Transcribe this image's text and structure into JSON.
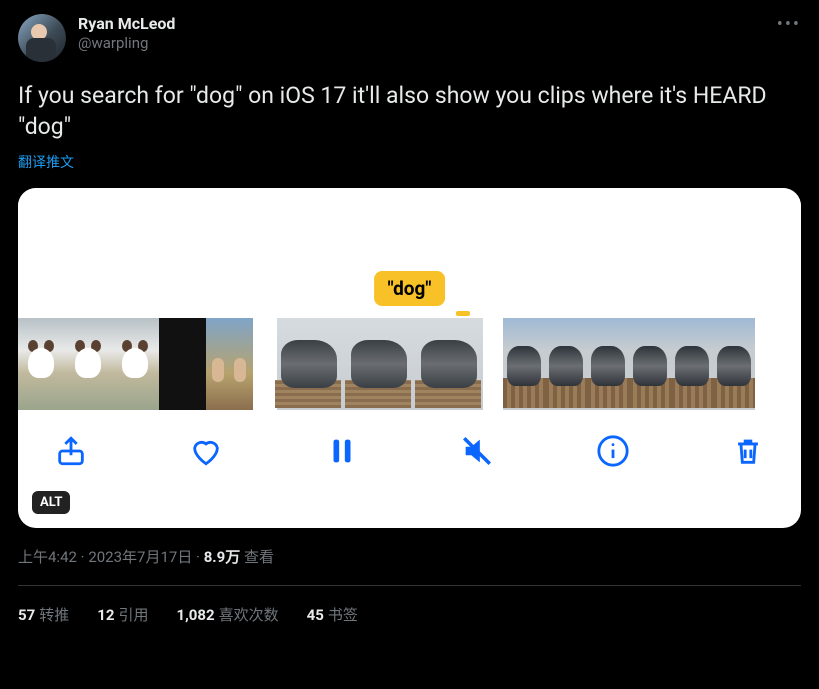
{
  "author": {
    "display_name": "Ryan McLeod",
    "handle": "@warpling"
  },
  "body_text": "If you search for \"dog\" on iOS 17 it'll also show you clips where it's HEARD \"dog\"",
  "translate_label": "翻译推文",
  "media": {
    "tag_label": "\"dog\"",
    "alt_badge": "ALT"
  },
  "meta": {
    "time": "上午4:42",
    "date": "2023年7月17日",
    "views_value": "8.9万",
    "views_label": "查看"
  },
  "stats": {
    "retweets_n": "57",
    "retweets_label": "转推",
    "quotes_n": "12",
    "quotes_label": "引用",
    "likes_n": "1,082",
    "likes_label": "喜欢次数",
    "bookmarks_n": "45",
    "bookmarks_label": "书签"
  }
}
